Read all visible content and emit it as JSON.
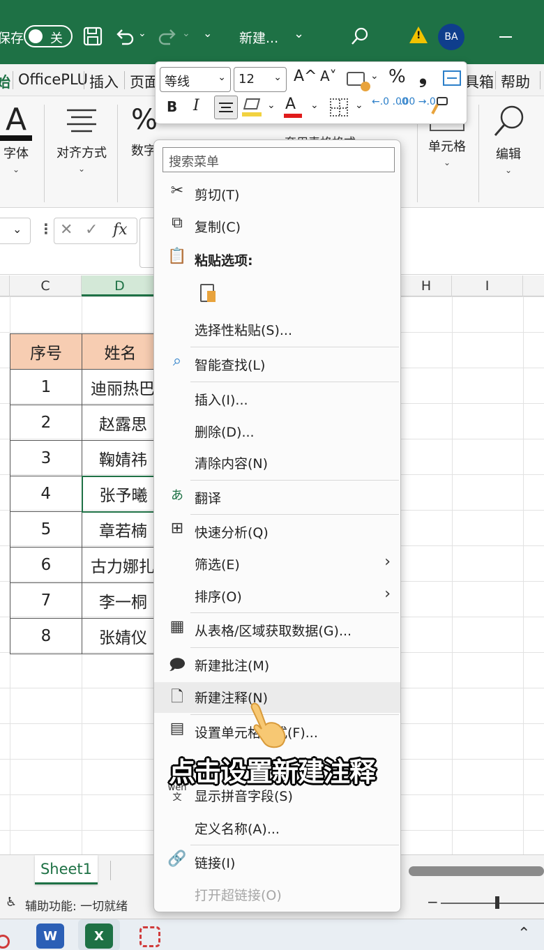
{
  "titlebar": {
    "autosave_label": "保存",
    "autosave_state": "关",
    "document_title": "新建...",
    "user_initials": "BA"
  },
  "ribbon_tabs": [
    "始",
    "OfficePLU",
    "插入",
    "页面",
    "工具箱",
    "帮助"
  ],
  "ribbon_groups": {
    "font": "字体",
    "align": "对齐方式",
    "number": "数字",
    "table_format": "套用表格格式",
    "cells": "单元格",
    "edit": "编辑"
  },
  "formula_bar": {
    "fx": "fx"
  },
  "columns": [
    "C",
    "D",
    "H",
    "I"
  ],
  "table": {
    "headers": [
      "序号",
      "姓名"
    ],
    "rows": [
      [
        "1",
        "迪丽热巴"
      ],
      [
        "2",
        "赵露思"
      ],
      [
        "3",
        "鞠婧祎"
      ],
      [
        "4",
        "张予曦"
      ],
      [
        "5",
        "章若楠"
      ],
      [
        "6",
        "古力娜扎"
      ],
      [
        "7",
        "李一桐"
      ],
      [
        "8",
        "张婧仪"
      ]
    ]
  },
  "mini_toolbar": {
    "font_name": "等线",
    "font_size": "12",
    "grow_font": "A^",
    "shrink_font": "A˅",
    "percent": "%",
    "comma": "❟",
    "bold": "B",
    "italic": "I",
    "increase_decimal": "←.0 .00",
    "decrease_decimal": ".00 →.0"
  },
  "context_menu": {
    "search_placeholder": "搜索菜单",
    "items": {
      "cut": "剪切(T)",
      "copy": "复制(C)",
      "paste_options": "粘贴选项:",
      "paste_special": "选择性粘贴(S)...",
      "smart_lookup": "智能查找(L)",
      "insert": "插入(I)...",
      "delete": "删除(D)...",
      "clear": "清除内容(N)",
      "translate": "翻译",
      "quick_analysis": "快速分析(Q)",
      "filter": "筛选(E)",
      "sort": "排序(O)",
      "get_data": "从表格/区域获取数据(G)...",
      "new_comment": "新建批注(M)",
      "new_note": "新建注释(N)",
      "format_cells": "设置单元格格式(F)...",
      "phonetic": "显示拼音字段(S)",
      "define_name": "定义名称(A)...",
      "link": "链接(I)",
      "open_hyperlink": "打开超链接(O)"
    }
  },
  "caption": "点击设置新建注释",
  "sheet_tab": "Sheet1",
  "status": "辅助功能: 一切就绪",
  "colors": {
    "title_green": "#1e7145",
    "header_fill": "#f7cdb2",
    "avatar_blue": "#0f3e8c"
  }
}
